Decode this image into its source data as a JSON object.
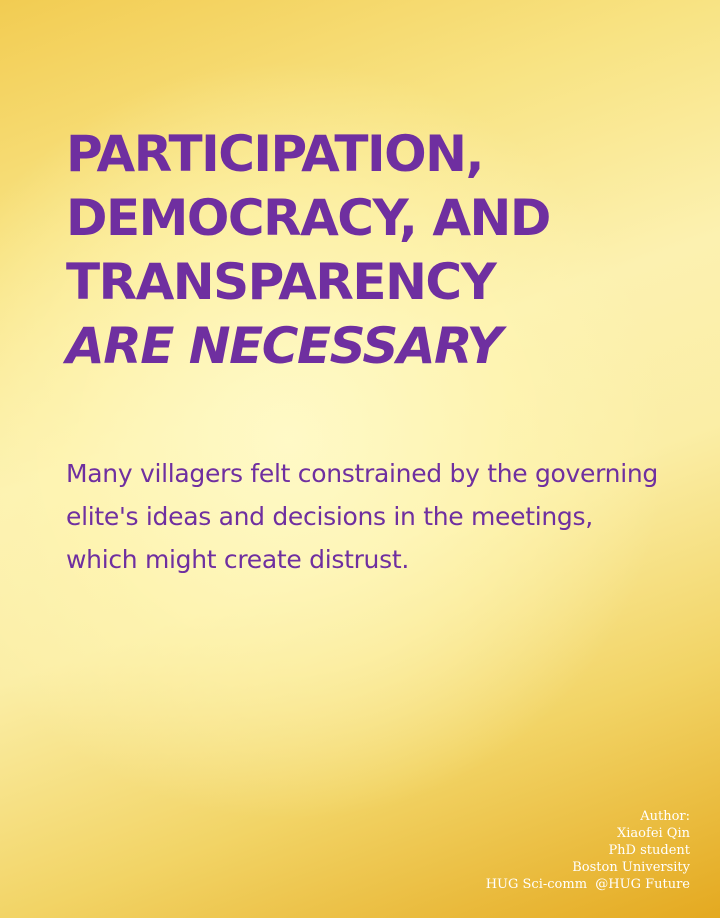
{
  "headline": {
    "line1": "PARTICIPATION,",
    "line2": "DEMOCRACY, AND",
    "line3": "TRANSPARENCY",
    "line4": "ARE NECESSARY"
  },
  "body": {
    "text": "Many villagers felt constrained by the governing elite's ideas and decisions in the meetings, which might create distrust."
  },
  "credits": {
    "author_label": "Author:",
    "name": "Xiaofei Qin",
    "role": "PhD student",
    "institution": "Boston University",
    "org": "HUG Sci-comm  @HUG Future"
  },
  "colors": {
    "headline": "#6f2fa0",
    "background_light": "#fcf1b0",
    "background_dark": "#e4a920",
    "credits": "#ffffff"
  }
}
